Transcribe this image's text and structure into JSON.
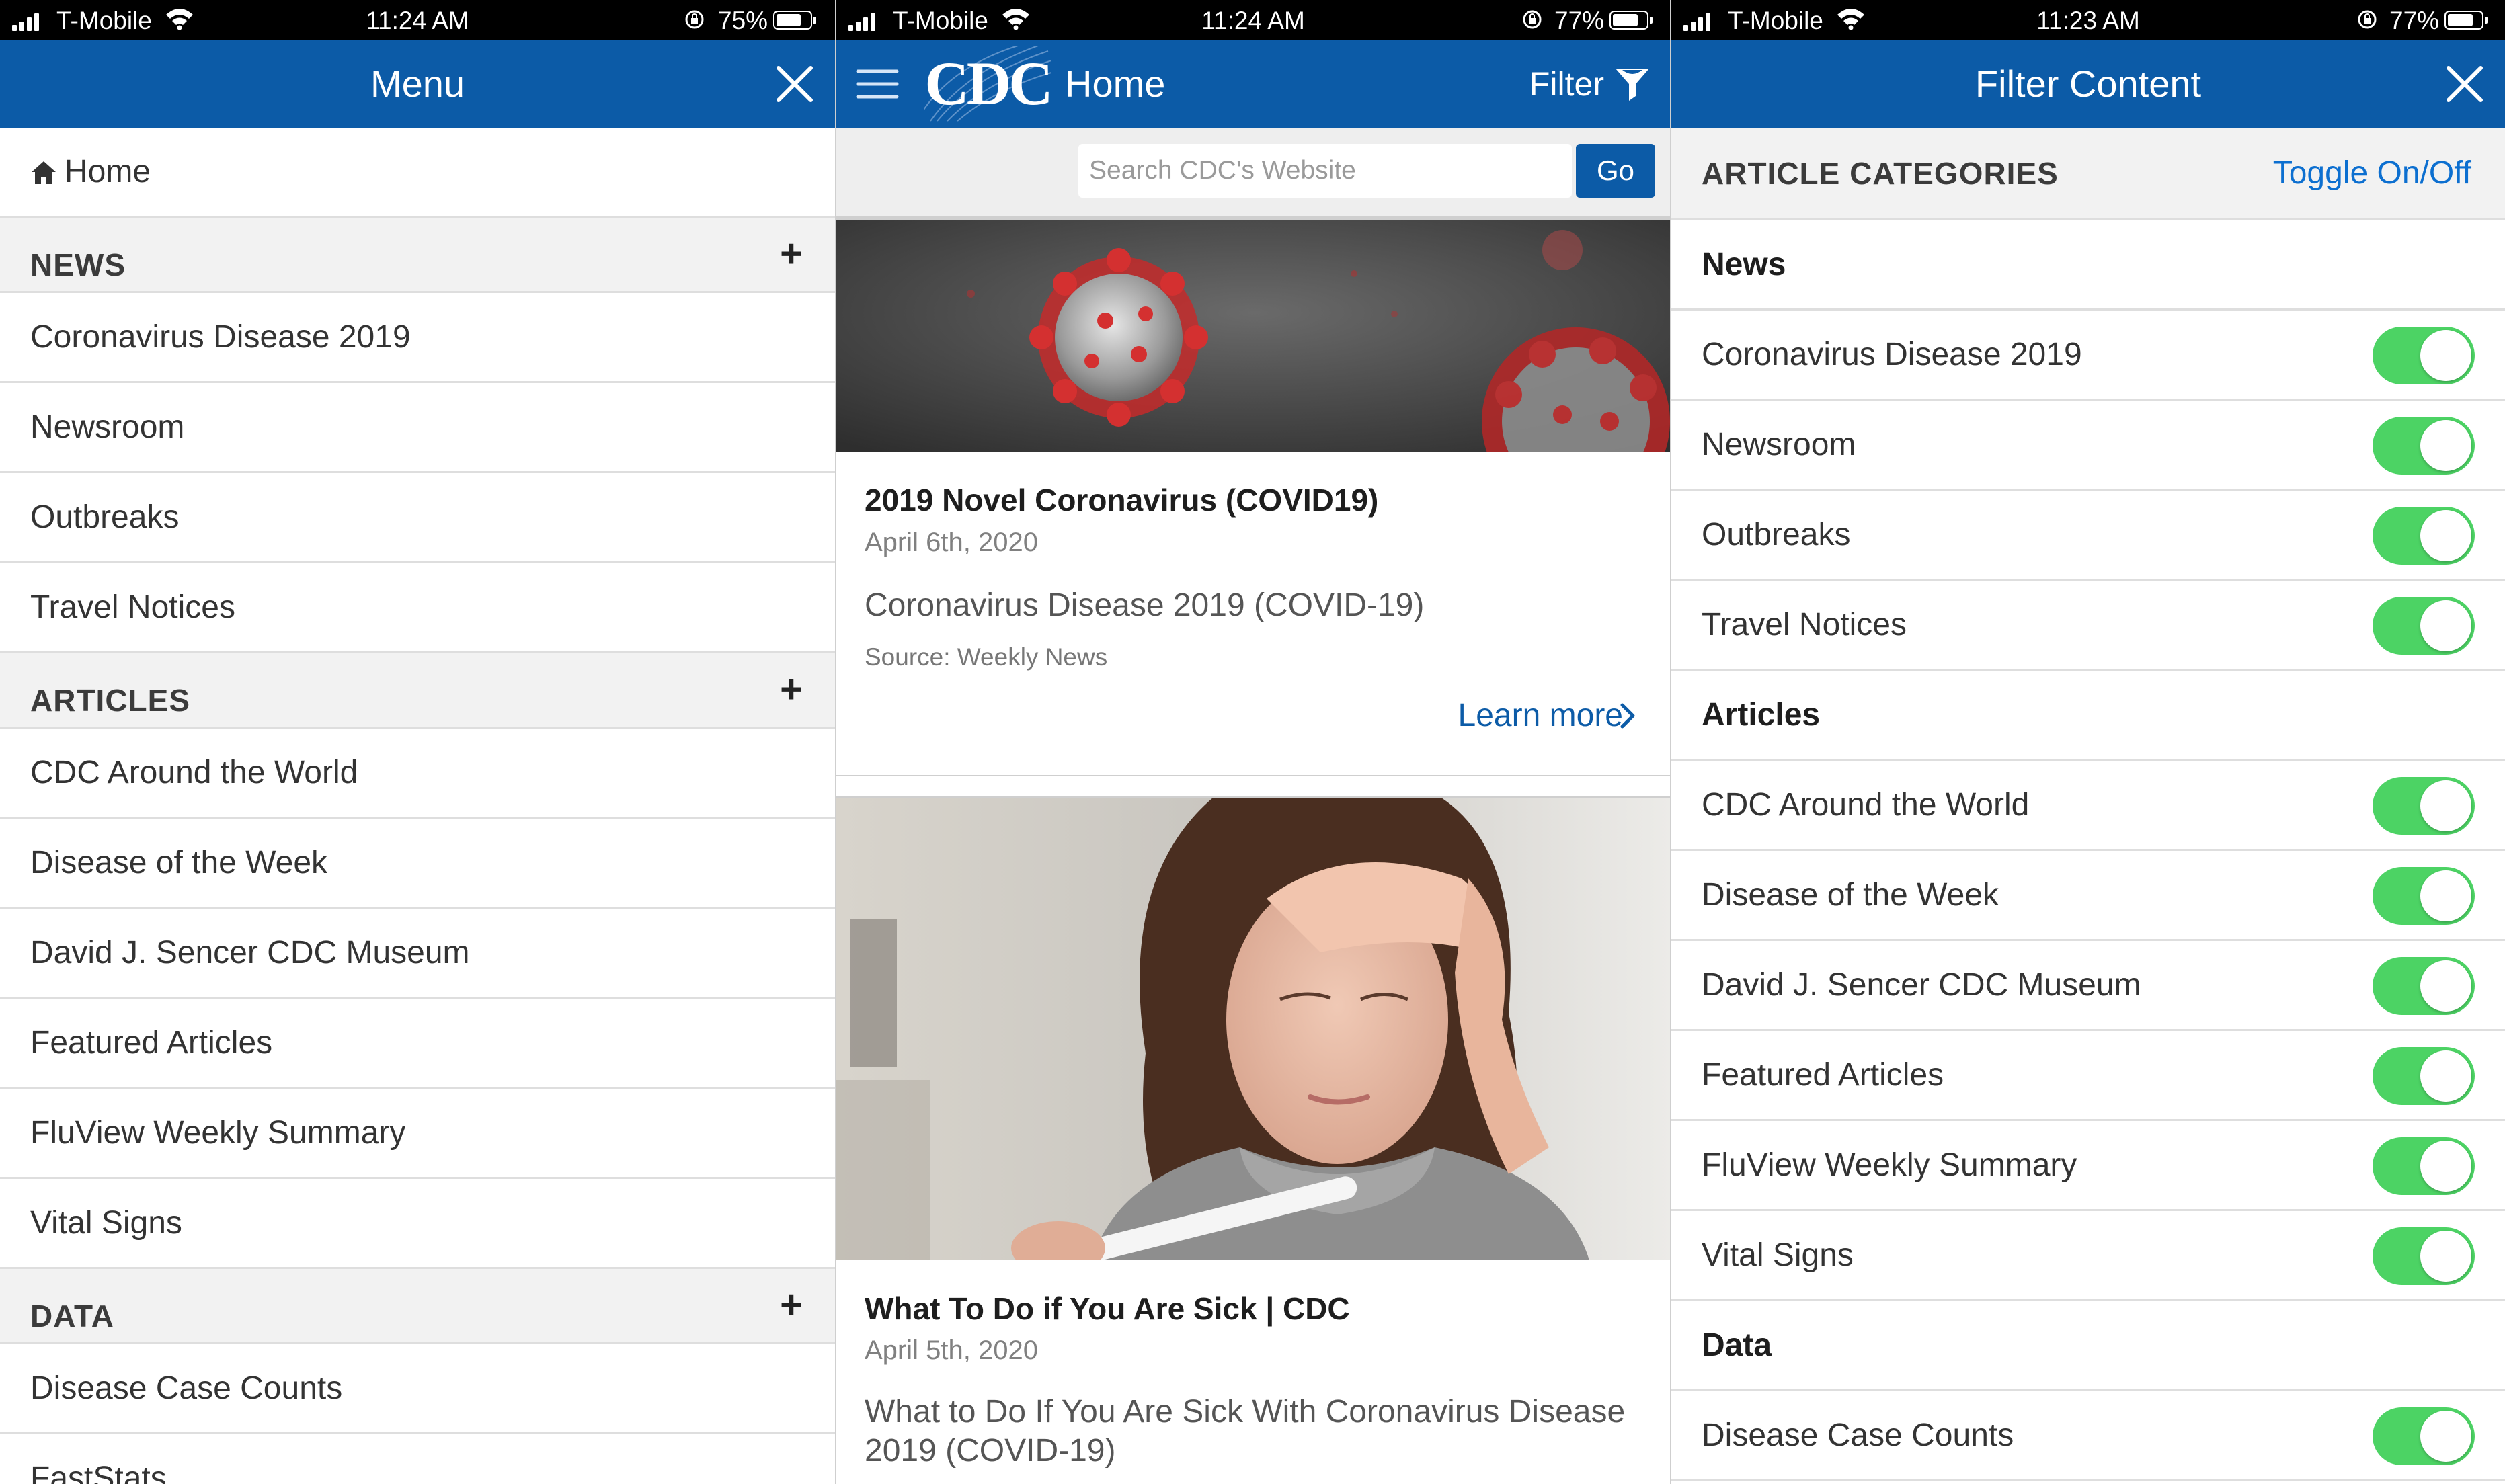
{
  "status_bars": [
    {
      "carrier": "T-Mobile",
      "time": "11:24 AM",
      "battery_pct": "75%",
      "battery_level": 0.75
    },
    {
      "carrier": "T-Mobile",
      "time": "11:24 AM",
      "battery_pct": "77%",
      "battery_level": 0.77
    },
    {
      "carrier": "T-Mobile",
      "time": "11:23 AM",
      "battery_pct": "77%",
      "battery_level": 0.77
    }
  ],
  "menu": {
    "title": "Menu",
    "home_label": "Home",
    "sections": [
      {
        "title": "NEWS",
        "items": [
          "Coronavirus Disease 2019",
          "Newsroom",
          "Outbreaks",
          "Travel Notices"
        ]
      },
      {
        "title": "ARTICLES",
        "items": [
          "CDC Around the World",
          "Disease of the Week",
          "David J. Sencer CDC Museum",
          "Featured Articles",
          "FluView Weekly Summary",
          "Vital Signs"
        ]
      },
      {
        "title": "DATA",
        "items": [
          "Disease Case Counts",
          "FastStats"
        ]
      }
    ]
  },
  "home": {
    "logo_text": "CDC",
    "title": "Home",
    "filter_label": "Filter",
    "search": {
      "placeholder": "Search CDC's Website",
      "go_label": "Go"
    },
    "cards": [
      {
        "title": "2019 Novel Coronavirus (COVID19)",
        "date": "April 6th, 2020",
        "description": "Coronavirus Disease 2019 (COVID-19)",
        "source": "Source: Weekly News",
        "link": "Learn more"
      },
      {
        "title": "What To Do if You Are Sick | CDC",
        "date": "April 5th, 2020",
        "description": "What to Do If You Are Sick With Coronavirus Disease 2019 (COVID-19)"
      }
    ]
  },
  "filter": {
    "title": "Filter Content",
    "section_label": "ARTICLE CATEGORIES",
    "toggle_label": "Toggle On/Off",
    "accent_color": "#4cd364",
    "groups": [
      {
        "title": "News",
        "items": [
          {
            "label": "Coronavirus Disease 2019",
            "on": true
          },
          {
            "label": "Newsroom",
            "on": true
          },
          {
            "label": "Outbreaks",
            "on": true
          },
          {
            "label": "Travel Notices",
            "on": true
          }
        ]
      },
      {
        "title": "Articles",
        "items": [
          {
            "label": "CDC Around the World",
            "on": true
          },
          {
            "label": "Disease of the Week",
            "on": true
          },
          {
            "label": "David J. Sencer CDC Museum",
            "on": true
          },
          {
            "label": "Featured Articles",
            "on": true
          },
          {
            "label": "FluView Weekly Summary",
            "on": true
          },
          {
            "label": "Vital Signs",
            "on": true
          }
        ]
      },
      {
        "title": "Data",
        "items": [
          {
            "label": "Disease Case Counts",
            "on": true
          }
        ]
      }
    ]
  },
  "colors": {
    "header_blue": "#0c5ba7",
    "link_blue": "#0c6fd0",
    "toggle_green": "#4cd364"
  }
}
